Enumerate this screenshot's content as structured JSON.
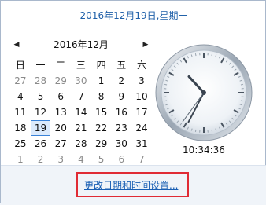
{
  "header": {
    "full_date": "2016年12月19日,星期一"
  },
  "calendar": {
    "month_title": "2016年12月",
    "prev_icon": "triangle-left-icon",
    "next_icon": "triangle-right-icon",
    "weekdays": [
      "日",
      "一",
      "二",
      "三",
      "四",
      "五",
      "六"
    ],
    "weeks": [
      [
        "27",
        "28",
        "29",
        "30",
        "1",
        "2",
        "3"
      ],
      [
        "4",
        "5",
        "6",
        "7",
        "8",
        "9",
        "10"
      ],
      [
        "11",
        "12",
        "13",
        "14",
        "15",
        "16",
        "17"
      ],
      [
        "18",
        "19",
        "20",
        "21",
        "22",
        "23",
        "24"
      ],
      [
        "25",
        "26",
        "27",
        "28",
        "29",
        "30",
        "31"
      ],
      [
        "1",
        "2",
        "3",
        "4",
        "5",
        "6",
        "7"
      ]
    ],
    "today": "19"
  },
  "clock": {
    "time_text": "10:34:36",
    "hour": 10,
    "minute": 34,
    "second": 36
  },
  "footer": {
    "settings_link": "更改日期和时间设置..."
  },
  "colors": {
    "accent": "#1e5fa8",
    "link": "#1a5fb4",
    "highlight_border": "#e02b35",
    "today_border": "#3a83d9"
  }
}
